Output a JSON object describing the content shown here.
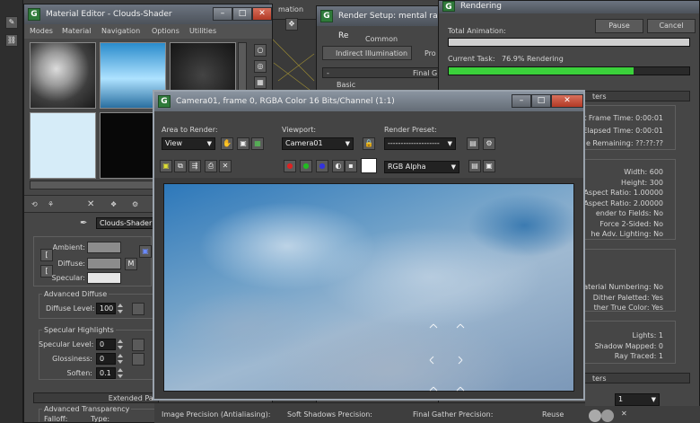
{
  "material_editor": {
    "title": "Material Editor - Clouds-Shader",
    "menu": [
      "Modes",
      "Material",
      "Navigation",
      "Options",
      "Utilities"
    ],
    "material_name": "Clouds-Shader",
    "basic": {
      "ambient_label": "Ambient:",
      "diffuse_label": "Diffuse:",
      "specular_label": "Specular:",
      "map_button": "M"
    },
    "advanced_diffuse": {
      "title": "Advanced Diffuse",
      "diffuse_level_label": "Diffuse Level:",
      "diffuse_level_value": "100"
    },
    "specular_highlights": {
      "title": "Specular Highlights",
      "specular_level_label": "Specular Level:",
      "specular_level_value": "0",
      "glossiness_label": "Glossiness:",
      "glossiness_value": "0",
      "soften_label": "Soften:",
      "soften_value": "0.1"
    },
    "extended_rollout": "Extended Par",
    "advanced_transparency": {
      "title": "Advanced Transparency",
      "falloff_label": "Falloff:",
      "type_label": "Type:"
    }
  },
  "render_setup": {
    "title": "Render Setup: mental ray Re",
    "tab_common": "Common",
    "tab_indirect": "Indirect Illumination",
    "tab_pro": "Pro",
    "rollout_final": "Final G",
    "rollout_basic": "Basic"
  },
  "rendering": {
    "title": "Rendering",
    "pause_label": "Pause",
    "cancel_label": "Cancel",
    "total_animation_label": "Total Animation:",
    "total_progress": 1.0,
    "current_task_label": "Current Task:",
    "current_task_value": "76.9%  Rendering",
    "current_progress": 0.769,
    "params_header": "ters",
    "frame_time": "t Frame Time:  0:00:01",
    "elapsed_time": "Elapsed Time:  0:00:01",
    "time_remaining": "e Remaining:  ??:??:??",
    "width": "Width:  600",
    "height": "Height:  300",
    "pixel_aspect": "el Aspect Ratio:  1.00000",
    "image_aspect": "ge Aspect Ratio:  2.00000",
    "render_fields": "ender to Fields:  No",
    "force_2sided": "Force 2-Sided:  No",
    "adv_lighting": "he Adv. Lighting:  No",
    "material_numbering": "aterial Numbering:  No",
    "dither_paletted": "Dither Paletted:  Yes",
    "dither_true_color": "ther True Color:  Yes",
    "lights": "Lights:  1",
    "shadow_mapped": "Shadow Mapped:  0",
    "ray_traced": "Ray Traced:  1",
    "bottom_header": "ters",
    "bottom_dropdown": "1"
  },
  "frame_window": {
    "title": "Camera01, frame 0, RGBA Color 16 Bits/Channel (1:1)",
    "area_to_render_label": "Area to Render:",
    "area_to_render_value": "View",
    "viewport_label": "Viewport:",
    "viewport_value": "Camera01",
    "render_preset_label": "Render Preset:",
    "render_preset_value": "--------------------",
    "channel_value": "RGB Alpha"
  },
  "bottom_panel": {
    "image_precision": "Image Precision (Antialiasing):",
    "soft_shadows": "Soft Shadows Precision:",
    "final_gather": "Final Gather Precision:",
    "reuse": "Reuse"
  },
  "colors": {
    "progress_green": "#3bd13b",
    "title_bar": "#5a616a",
    "close_red": "#c0452f"
  }
}
